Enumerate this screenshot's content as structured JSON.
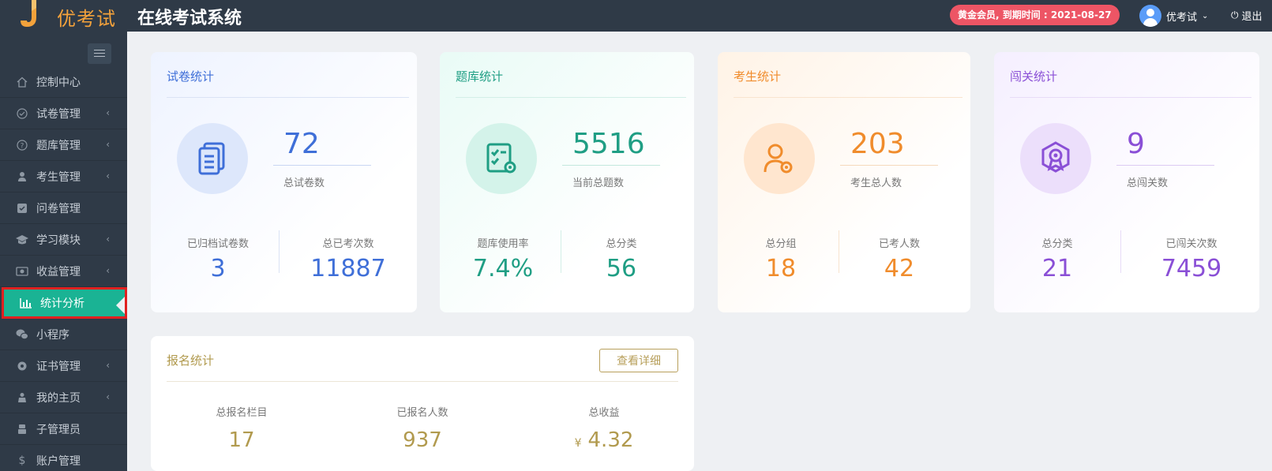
{
  "header": {
    "logo_text": "优考试",
    "app_title": "在线考试系统",
    "member_badge": "黄金会员, 到期时间 : 2021-08-27",
    "user_name": "优考试",
    "logout_label": "退出"
  },
  "sidebar": {
    "items": [
      {
        "label": "控制中心",
        "icon": "home-icon",
        "has_arrow": false
      },
      {
        "label": "试卷管理",
        "icon": "check-circle-icon",
        "has_arrow": true
      },
      {
        "label": "题库管理",
        "icon": "question-circle-icon",
        "has_arrow": true
      },
      {
        "label": "考生管理",
        "icon": "user-icon",
        "has_arrow": true
      },
      {
        "label": "问卷管理",
        "icon": "checkbox-icon",
        "has_arrow": false
      },
      {
        "label": "学习模块",
        "icon": "graduation-cap-icon",
        "has_arrow": true
      },
      {
        "label": "收益管理",
        "icon": "money-icon",
        "has_arrow": true
      },
      {
        "label": "统计分析",
        "icon": "bar-chart-icon",
        "has_arrow": false,
        "active": true
      },
      {
        "label": "小程序",
        "icon": "wechat-icon",
        "has_arrow": false
      },
      {
        "label": "证书管理",
        "icon": "certificate-icon",
        "has_arrow": true
      },
      {
        "label": "我的主页",
        "icon": "person-home-icon",
        "has_arrow": true
      },
      {
        "label": "子管理员",
        "icon": "sub-admin-icon",
        "has_arrow": false
      },
      {
        "label": "账户管理",
        "icon": "dollar-icon",
        "has_arrow": false
      }
    ]
  },
  "cards": {
    "paper": {
      "title": "试卷统计",
      "big_value": "72",
      "big_label": "总试卷数",
      "left_label": "已归档试卷数",
      "left_value": "3",
      "right_label": "总已考次数",
      "right_value": "11887",
      "color": "#3f6fd8"
    },
    "bank": {
      "title": "题库统计",
      "big_value": "5516",
      "big_label": "当前总题数",
      "left_label": "题库使用率",
      "left_value": "7.4%",
      "right_label": "总分类",
      "right_value": "56",
      "color": "#1f9e84"
    },
    "examinee": {
      "title": "考生统计",
      "big_value": "203",
      "big_label": "考生总人数",
      "left_label": "总分组",
      "left_value": "18",
      "right_label": "已考人数",
      "right_value": "42",
      "color": "#f08c2c"
    },
    "level": {
      "title": "闯关统计",
      "big_value": "9",
      "big_label": "总闯关数",
      "left_label": "总分类",
      "left_value": "21",
      "right_label": "已闯关次数",
      "right_value": "7459",
      "color": "#8a4fd6"
    },
    "signup": {
      "title": "报名统计",
      "detail_label": "查看详细",
      "items": [
        {
          "label": "总报名栏目",
          "value": "17"
        },
        {
          "label": "已报名人数",
          "value": "937"
        },
        {
          "label": "总收益",
          "value": "4.32",
          "prefix": "¥"
        }
      ],
      "color": "#b19a4e"
    }
  }
}
